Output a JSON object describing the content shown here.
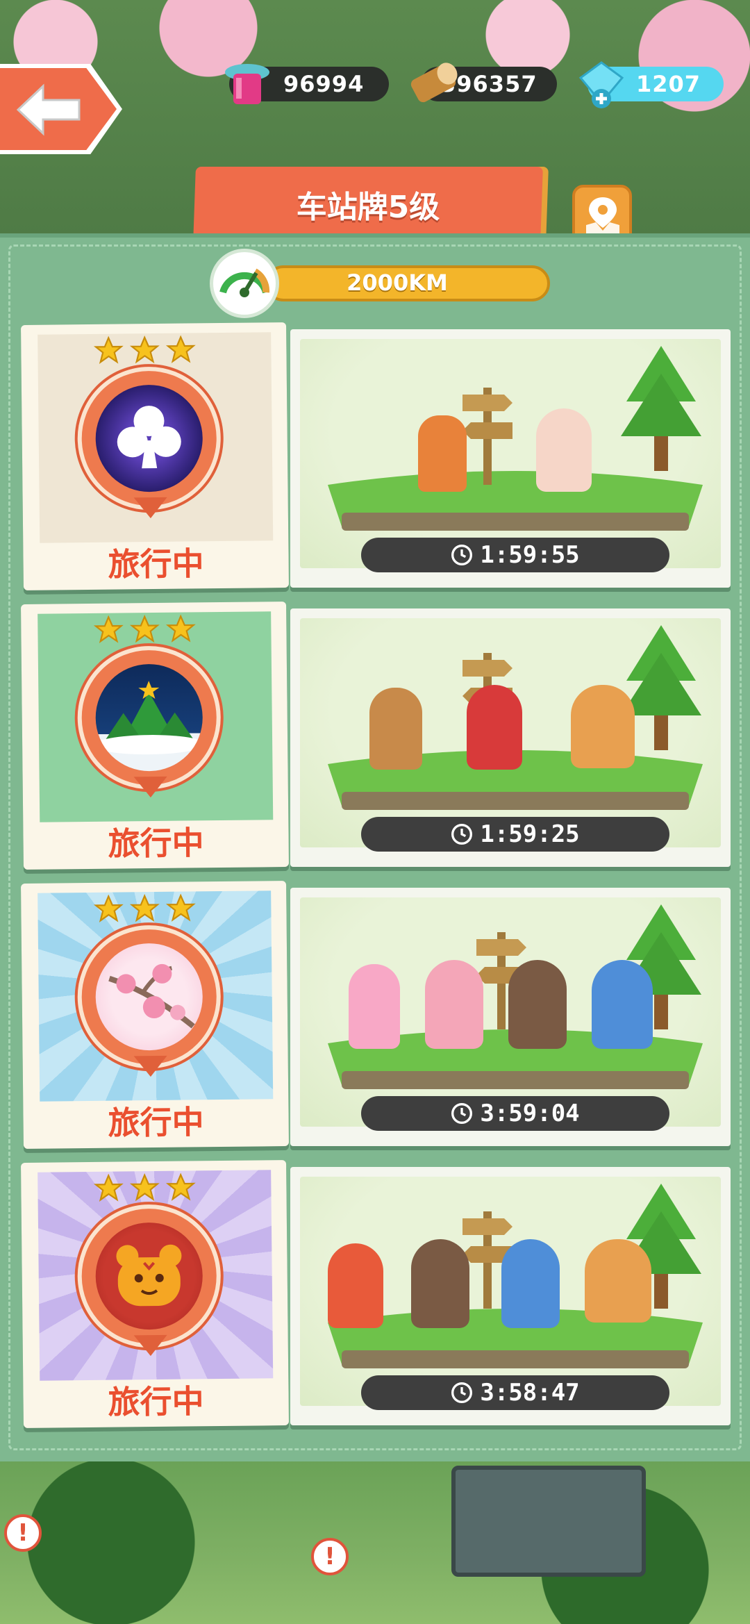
{
  "resources": {
    "hearts": "96994",
    "wood": "396357",
    "gems": "1207"
  },
  "title": "车站牌5级",
  "distance": "2000KM",
  "cards": [
    {
      "badge": "club-icon",
      "status": "旅行中",
      "timer": "1:59:55",
      "stars": 3
    },
    {
      "badge": "christmas-tree-icon",
      "status": "旅行中",
      "timer": "1:59:25",
      "stars": 3
    },
    {
      "badge": "cherry-blossom-icon",
      "status": "旅行中",
      "timer": "3:59:04",
      "stars": 3
    },
    {
      "badge": "tiger-icon",
      "status": "旅行中",
      "timer": "3:58:47",
      "stars": 3
    }
  ],
  "colors": {
    "accent_orange": "#ef6c4a",
    "status_red": "#ea4f2f",
    "panel_green": "#7fb890",
    "gem_blue": "#55d7f0"
  }
}
